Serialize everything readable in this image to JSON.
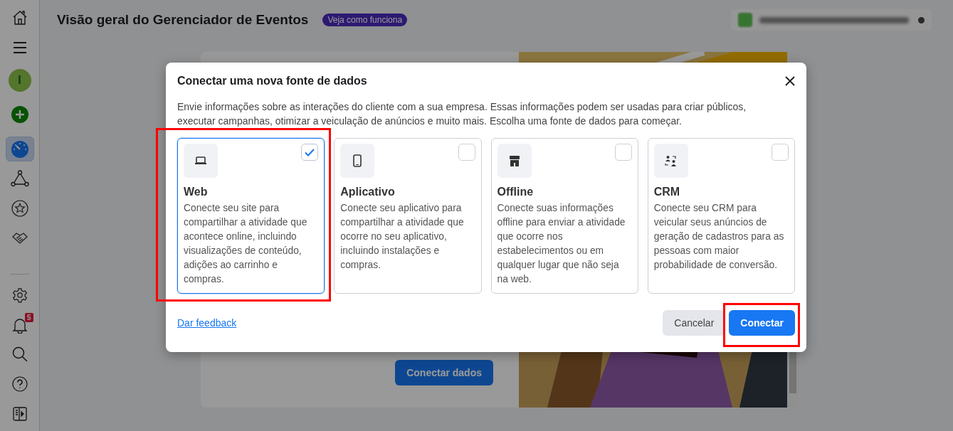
{
  "sidebar": {
    "avatar": "I",
    "top_items": [
      {
        "kind": "home",
        "selected": false
      },
      {
        "kind": "menu",
        "selected": false
      },
      {
        "kind": "avatar",
        "selected": false
      },
      {
        "kind": "add",
        "selected": false
      },
      {
        "kind": "gauge",
        "selected": true
      },
      {
        "kind": "graph",
        "selected": false
      },
      {
        "kind": "star",
        "selected": false
      },
      {
        "kind": "handshake",
        "selected": false
      }
    ],
    "bottom_items": [
      {
        "kind": "settings",
        "selected": false
      },
      {
        "kind": "bell",
        "selected": false,
        "badge": "5"
      },
      {
        "kind": "search",
        "selected": false
      },
      {
        "kind": "help",
        "selected": false
      },
      {
        "kind": "panel",
        "selected": false
      }
    ]
  },
  "page": {
    "title": "Visão geral do Gerenciador de Eventos",
    "help_badge": "Veja como funciona",
    "card_button": "Conectar dados"
  },
  "modal": {
    "title": "Conectar uma nova fonte de dados",
    "description": "Envie informações sobre as interações do cliente com a sua empresa. Essas informações podem ser usadas para criar públicos, executar campanhas, otimizar a veiculação de anúncios e muito mais. Escolha uma fonte de dados para começar.",
    "sources": [
      {
        "kind": "web",
        "title": "Web",
        "description": "Conecte seu site para compartilhar a atividade que acontece online, incluindo visualizações de conteúdo, adições ao carrinho e compras.",
        "selected": true,
        "highlighted": true
      },
      {
        "kind": "app",
        "title": "Aplicativo",
        "description": "Conecte seu aplicativo para compartilhar a atividade que ocorre no seu aplicativo, incluindo instalações e compras.",
        "selected": false,
        "highlighted": false
      },
      {
        "kind": "offline",
        "title": "Offline",
        "description": "Conecte suas informações offline para enviar a atividade que ocorre nos estabelecimentos ou em qualquer lugar que não seja na web.",
        "selected": false,
        "highlighted": false
      },
      {
        "kind": "crm",
        "title": "CRM",
        "description": "Conecte seu CRM para veicular seus anúncios de geração de cadastros para as pessoas com maior probabilidade de conversão.",
        "selected": false,
        "highlighted": false
      }
    ],
    "feedback_link": "Dar feedback",
    "buttons": [
      {
        "kind": "secondary",
        "label": "Cancelar",
        "highlighted": false
      },
      {
        "kind": "primary",
        "label": "Conectar",
        "highlighted": true
      }
    ]
  }
}
